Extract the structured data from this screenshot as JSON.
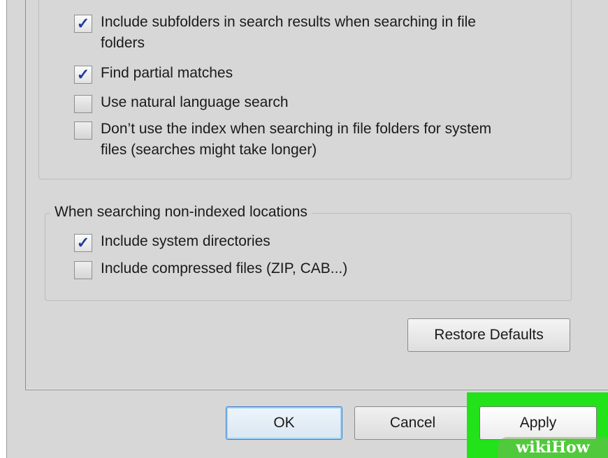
{
  "search_options": {
    "options": [
      {
        "label": "Include subfolders in search results when searching in file folders",
        "line1": "Include subfolders in search results when searching in file",
        "line2": "folders",
        "checked": true
      },
      {
        "label": "Find partial matches",
        "checked": true
      },
      {
        "label": "Use natural language search",
        "checked": false
      },
      {
        "label": "Don’t use the index when searching in file folders for system files (searches might take longer)",
        "line1": "Don’t use the index when searching in file folders for system",
        "line2": "files (searches might take longer)",
        "checked": false
      }
    ]
  },
  "non_indexed": {
    "legend": "When searching non-indexed locations",
    "options": [
      {
        "label": "Include system directories",
        "checked": true
      },
      {
        "label": "Include compressed files (ZIP, CAB...)",
        "checked": false
      }
    ]
  },
  "buttons": {
    "restore_defaults": "Restore Defaults",
    "ok": "OK",
    "cancel": "Cancel",
    "apply": "Apply"
  },
  "checkmark_glyph": "✓",
  "watermark": "wikiHow",
  "colors": {
    "highlight": "#22e21a",
    "checkmark": "#1f3d9a",
    "ok_focus_border": "#3b7fc9"
  }
}
